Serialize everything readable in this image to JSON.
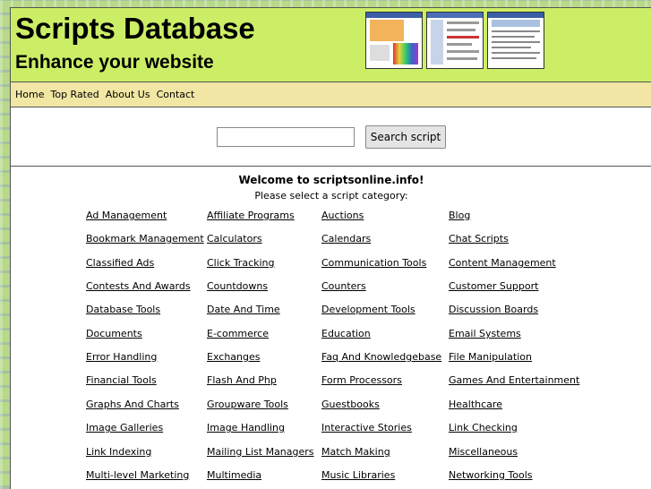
{
  "header": {
    "title": "Scripts Database",
    "tagline": "Enhance your website"
  },
  "nav": [
    "Home",
    "Top Rated",
    "About Us",
    "Contact"
  ],
  "search": {
    "placeholder": "",
    "value": "",
    "button_label": "Search script"
  },
  "main": {
    "welcome": "Welcome to scriptsonline.info!",
    "subtitle": "Please select a script category:"
  },
  "categories": [
    "Ad Management",
    "Affiliate Programs",
    "Auctions",
    "Blog",
    "Bookmark Management",
    "Calculators",
    "Calendars",
    "Chat Scripts",
    "Classified Ads",
    "Click Tracking",
    "Communication Tools",
    "Content Management",
    "Contests And Awards",
    "Countdowns",
    "Counters",
    "Customer Support",
    "Database Tools",
    "Date And Time",
    "Development Tools",
    "Discussion Boards",
    "Documents",
    "E-commerce",
    "Education",
    "Email Systems",
    "Error Handling",
    "Exchanges",
    "Faq And Knowledgebase",
    "File Manipulation",
    "Financial Tools",
    "Flash And Php",
    "Form Processors",
    "Games And Entertainment",
    "Graphs And Charts",
    "Groupware Tools",
    "Guestbooks",
    "Healthcare",
    "Image Galleries",
    "Image Handling",
    "Interactive Stories",
    "Link Checking",
    "Link Indexing",
    "Mailing List Managers",
    "Match Making",
    "Miscellaneous",
    "Multi-level Marketing",
    "Multimedia",
    "Music Libraries",
    "Networking Tools"
  ]
}
